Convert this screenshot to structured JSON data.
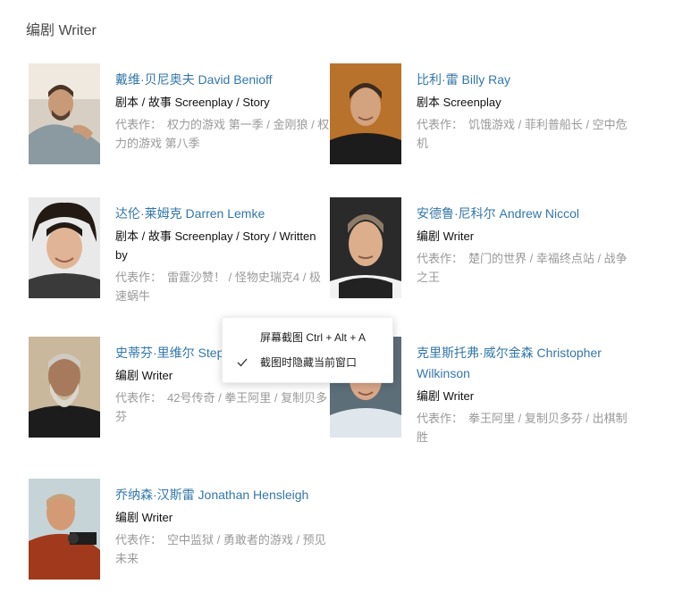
{
  "section": {
    "title": "编剧 Writer"
  },
  "writers": [
    {
      "name": "戴维·贝尼奥夫 David Benioff",
      "role": "剧本 / 故事 Screenplay / Story",
      "works_label": "代表作：",
      "works": "权力的游戏 第一季 / 金刚狼 / 权力的游戏 第八季",
      "photo": "portrait-man-beard-sitting"
    },
    {
      "name": "比利·雷 Billy Ray",
      "role": "剧本 Screenplay",
      "works_label": "代表作：",
      "works": "饥饿游戏 / 菲利普船长 / 空中危机",
      "photo": "portrait-man-black-shirt"
    },
    {
      "name": "达伦·莱姆克 Darren Lemke",
      "role": "剧本 / 故事 Screenplay / Story / Written by",
      "works_label": "代表作：",
      "works": "雷霆沙赞！ / 怪物史瑞克4 / 极速蜗牛",
      "photo": "portrait-man-curly-hair"
    },
    {
      "name": "安德鲁·尼科尔 Andrew Niccol",
      "role": "编剧 Writer",
      "works_label": "代表作：",
      "works": "楚门的世界 / 幸福终点站 / 战争之王",
      "photo": "portrait-man-short-hair"
    },
    {
      "name": "史蒂芬·里维尔 Stephen",
      "role": "编剧 Writer",
      "works_label": "代表作：",
      "works": "42号传奇 / 拳王阿里 / 复制贝多芬",
      "photo": "portrait-man-white-beard"
    },
    {
      "name": "克里斯托弗·威尔金森 Christopher Wilkinson",
      "role": "编剧 Writer",
      "works_label": "代表作：",
      "works": "拳王阿里 / 复制贝多芬 / 出棋制胜",
      "photo": "portrait-man-white-hair"
    },
    {
      "name": "乔纳森·汉斯雷 Jonathan Hensleigh",
      "role": "编剧 Writer",
      "works_label": "代表作：",
      "works": "空中监狱 / 勇敢者的游戏 / 预见未来",
      "photo": "portrait-man-camera"
    }
  ],
  "context_menu": {
    "items": [
      {
        "label": "屏幕截图 Ctrl + Alt + A",
        "checked": false
      },
      {
        "label": "截图时隐藏当前窗口",
        "checked": true
      }
    ]
  },
  "colors": {
    "link": "#3377aa",
    "muted": "#999999",
    "text": "#111111"
  }
}
